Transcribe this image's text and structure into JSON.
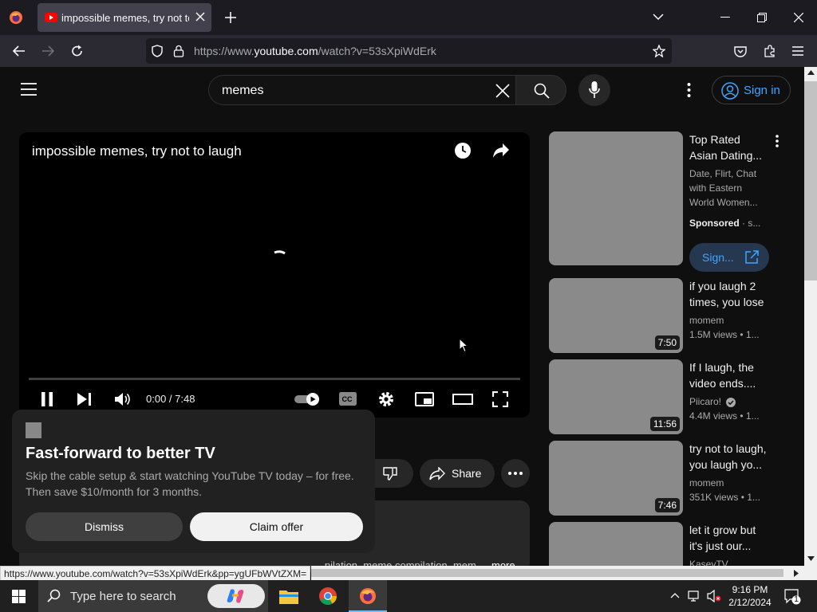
{
  "browser": {
    "tab_title": "impossible memes, try not to laugh - YouTube",
    "url_prefix": "https://www.",
    "url_domain": "youtube.com",
    "url_path": "/watch?v=53sXpiWdErk",
    "status_url": "https://www.youtube.com/watch?v=53sXpiWdErk&pp=ygUFbWVtZXM="
  },
  "header": {
    "search_value": "memes",
    "signin_label": "Sign in"
  },
  "player": {
    "title": "impossible memes, try not to laugh",
    "time": "0:00 / 7:48",
    "progress": 0
  },
  "popup": {
    "title": "Fast-forward to better TV",
    "body": "Skip the cable setup & start watching YouTube TV today – for free. Then save $10/month for 3 months.",
    "dismiss": "Dismiss",
    "claim": "Claim offer"
  },
  "actions": {
    "share": "Share"
  },
  "description": {
    "text": "...pilation, meme compilation, mem...",
    "more": "more"
  },
  "sidebar": {
    "ad": {
      "title": "Top Rated Asian Dating...",
      "desc": "Date, Flirt, Chat with Eastern World Women...",
      "sponsored": "Sponsored",
      "sponsored_tail": "s...",
      "cta": "Sign..."
    },
    "videos": [
      {
        "title": "if you laugh 2 times, you lose",
        "channel": "momem",
        "meta": "1.5M views • 1...",
        "duration": "7:50"
      },
      {
        "title": "If I laugh, the video ends....",
        "channel": "Piicaro!",
        "meta": "4.4M views • 1...",
        "duration": "11:56"
      },
      {
        "title": "try not to laugh, you laugh yo...",
        "channel": "momem",
        "meta": "351K views • 1...",
        "duration": "7:46"
      },
      {
        "title": "let it grow but it's just our...",
        "channel": "KaseyTV",
        "meta": "",
        "duration": ""
      }
    ]
  },
  "taskbar": {
    "search_placeholder": "Type here to search",
    "time": "9:16 PM",
    "date": "2/12/2024",
    "notification_count": "1"
  },
  "colors": {
    "youtube_red": "#ff0000",
    "signin_blue": "#3ea6ff",
    "firefox_orange": "#ff7139"
  }
}
